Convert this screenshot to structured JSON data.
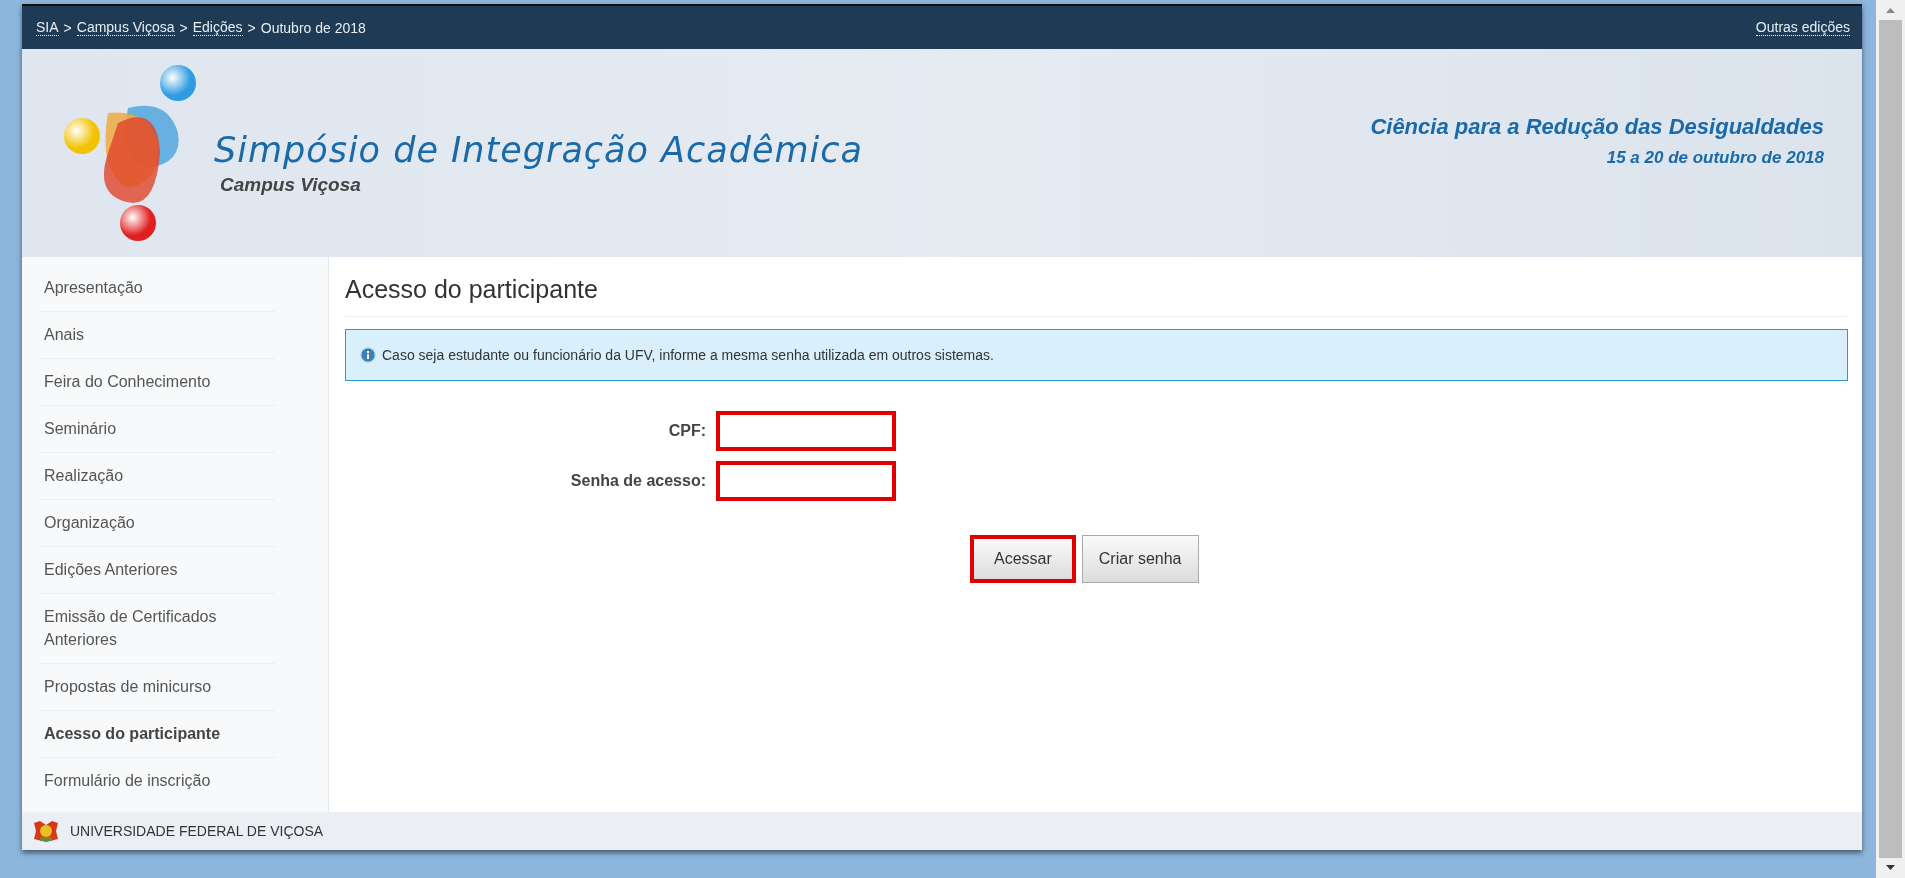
{
  "breadcrumb": [
    {
      "label": "SIA",
      "link": true
    },
    {
      "label": "Campus Viçosa",
      "link": true
    },
    {
      "label": "Edições",
      "link": true
    },
    {
      "label": "Outubro de 2018",
      "link": false
    }
  ],
  "breadcrumb_separator": ">",
  "top_link": "Outras edições",
  "header": {
    "title": "Simpósio de Integração Acadêmica",
    "subtitle": "Campus Viçosa",
    "theme": "Ciência para a Redução das Desigualdades",
    "dates": "15 a 20 de outubro de 2018"
  },
  "sidebar": {
    "items": [
      {
        "label": "Apresentação",
        "selected": false
      },
      {
        "label": "Anais",
        "selected": false
      },
      {
        "label": "Feira do Conhecimento",
        "selected": false
      },
      {
        "label": "Seminário",
        "selected": false
      },
      {
        "label": "Realização",
        "selected": false
      },
      {
        "label": "Organização",
        "selected": false
      },
      {
        "label": "Edições Anteriores",
        "selected": false
      },
      {
        "label": "Emissão de Certificados Anteriores",
        "selected": false
      },
      {
        "label": "Propostas de minicurso",
        "selected": false
      },
      {
        "label": "Acesso do participante",
        "selected": true
      },
      {
        "label": "Formulário de inscrição",
        "selected": false
      }
    ]
  },
  "content": {
    "title": "Acesso do participante",
    "info": "Caso seja estudante ou funcionário da UFV, informe a mesma senha utilizada em outros sistemas.",
    "fields": [
      {
        "label": "CPF:",
        "highlighted": true
      },
      {
        "label": "Senha de acesso:",
        "highlighted": true
      }
    ],
    "buttons": [
      {
        "label": "Acessar",
        "highlighted": true
      },
      {
        "label": "Criar senha",
        "highlighted": false
      }
    ]
  },
  "footer": {
    "text": "UNIVERSIDADE FEDERAL DE VIÇOSA"
  }
}
